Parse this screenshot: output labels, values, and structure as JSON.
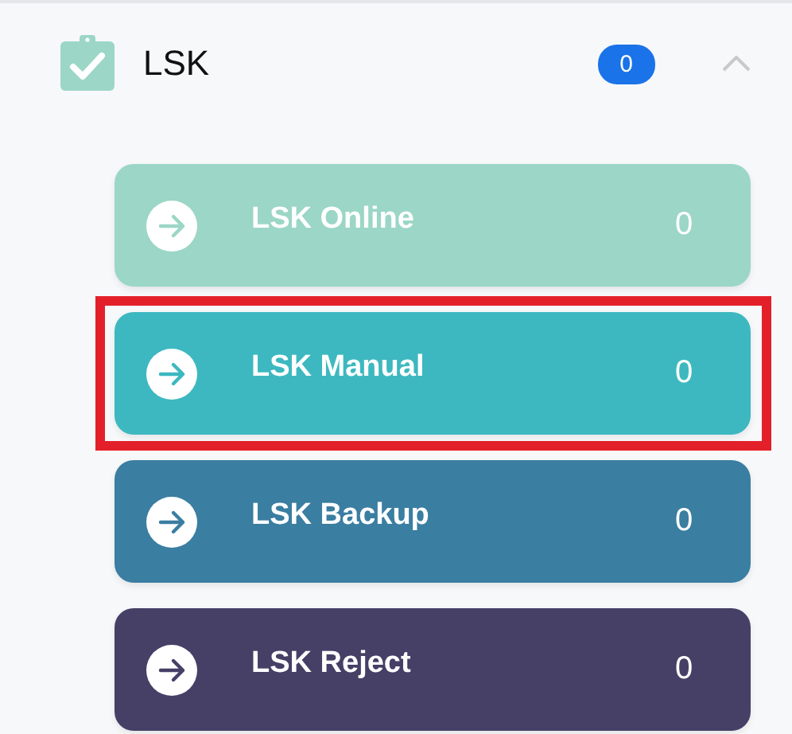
{
  "section": {
    "title": "LSK",
    "badge": "0",
    "expanded": true
  },
  "items": [
    {
      "label": "LSK Online",
      "count": "0",
      "color": "#9bd6c6",
      "highlighted": false
    },
    {
      "label": "LSK Manual",
      "count": "0",
      "color": "#3db8c0",
      "highlighted": true
    },
    {
      "label": "LSK Backup",
      "count": "0",
      "color": "#3a7ea1",
      "highlighted": false
    },
    {
      "label": "LSK Reject",
      "count": "0",
      "color": "#463f66",
      "highlighted": false
    }
  ]
}
